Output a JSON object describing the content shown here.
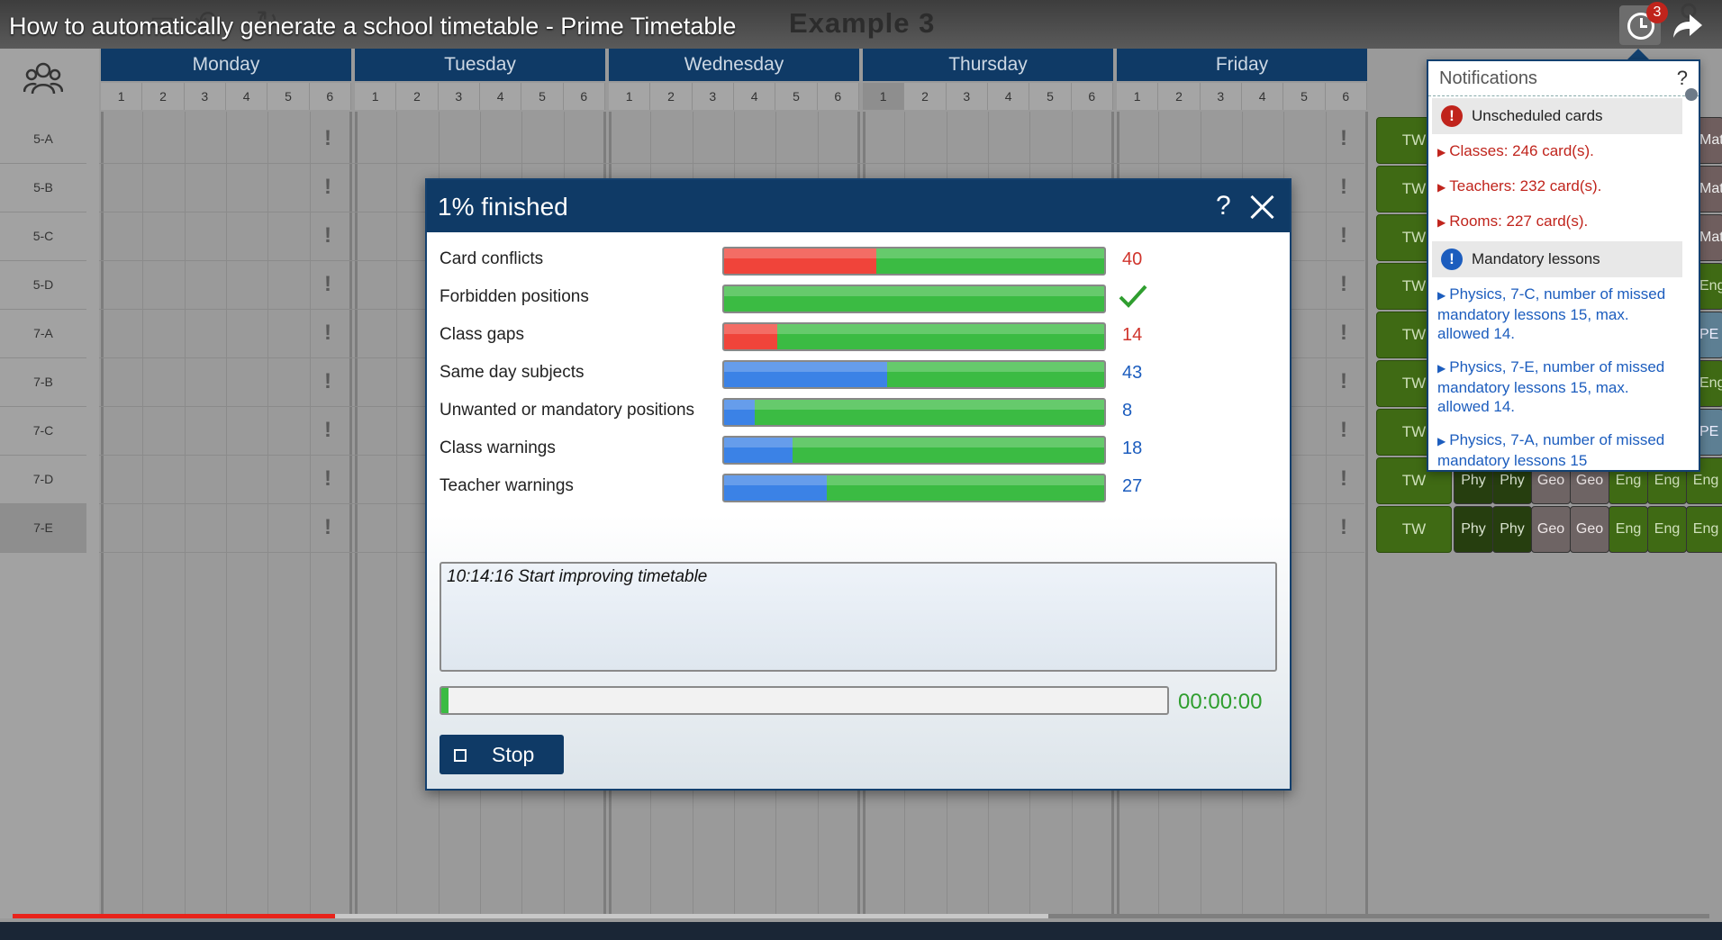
{
  "video": {
    "title": "How to automatically generate a school timetable - Prime Timetable",
    "played_fraction": 0.19
  },
  "app": {
    "document_title": "Example 3",
    "notifications_count": "3"
  },
  "timetable": {
    "days": [
      "Monday",
      "Tuesday",
      "Wednesday",
      "Thursday",
      "Friday"
    ],
    "periods": [
      "1",
      "2",
      "3",
      "4",
      "5",
      "6"
    ],
    "classes": [
      "5-A",
      "5-B",
      "5-C",
      "5-D",
      "7-A",
      "7-B",
      "7-C",
      "7-D",
      "7-E"
    ],
    "right_cells": {
      "tw": "TW",
      "row_7d": [
        "Phy",
        "Phy",
        "Geo",
        "Geo",
        "Eng",
        "Eng",
        "Eng"
      ],
      "row_7e": [
        "Phy",
        "Phy",
        "Geo",
        "Geo",
        "Eng",
        "Eng",
        "Eng"
      ],
      "partial": [
        "Mat",
        "Mat",
        "Mat",
        "Eng",
        "PE",
        "Eng",
        "PE"
      ]
    }
  },
  "notifications": {
    "title": "Notifications",
    "help": "?",
    "sections": [
      {
        "label": "Unscheduled cards",
        "icon": "error-icon",
        "color": "#c0241c",
        "items": [
          "Classes: 246 card(s).",
          "Teachers: 232 card(s).",
          "Rooms: 227 card(s)."
        ]
      },
      {
        "label": "Mandatory lessons",
        "icon": "info-icon",
        "color": "#1c5dbe",
        "items": [
          "Physics, 7-C, number of missed mandatory lessons 15, max. allowed 14.",
          "Physics, 7-E, number of missed mandatory lessons 15, max. allowed 14.",
          "Physics, 7-A, number of missed mandatory lessons 15"
        ]
      }
    ]
  },
  "dialog": {
    "title": "1% finished",
    "help": "?",
    "metrics": [
      {
        "label": "Card conflicts",
        "value": "40",
        "bad_fraction": 0.4,
        "bad_color": "#f0443a",
        "value_color": "#d0342c"
      },
      {
        "label": "Forbidden positions",
        "value": "",
        "bad_fraction": 0,
        "bad_color": "#3bbb43",
        "value_color": "#2f9e2f",
        "check": true
      },
      {
        "label": "Class gaps",
        "value": "14",
        "bad_fraction": 0.14,
        "bad_color": "#f0443a",
        "value_color": "#d0342c"
      },
      {
        "label": "Same day subjects",
        "value": "43",
        "bad_fraction": 0.43,
        "bad_color": "#3b82e6",
        "value_color": "#1c5dbe"
      },
      {
        "label": "Unwanted or mandatory positions",
        "value": "8",
        "bad_fraction": 0.08,
        "bad_color": "#3b82e6",
        "value_color": "#1c5dbe"
      },
      {
        "label": "Class warnings",
        "value": "18",
        "bad_fraction": 0.18,
        "bad_color": "#3b82e6",
        "value_color": "#1c5dbe"
      },
      {
        "label": "Teacher warnings",
        "value": "27",
        "bad_fraction": 0.27,
        "bad_color": "#3b82e6",
        "value_color": "#1c5dbe"
      }
    ],
    "log": [
      "10:14:16 Start improving timetable"
    ],
    "progress_fraction": 0.01,
    "timer": "00:00:00",
    "stop_label": "Stop"
  },
  "colors": {
    "header_blue": "#0f3a66",
    "ok_green": "#3bbb43",
    "error_red": "#c0241c",
    "info_blue": "#1c5dbe"
  }
}
